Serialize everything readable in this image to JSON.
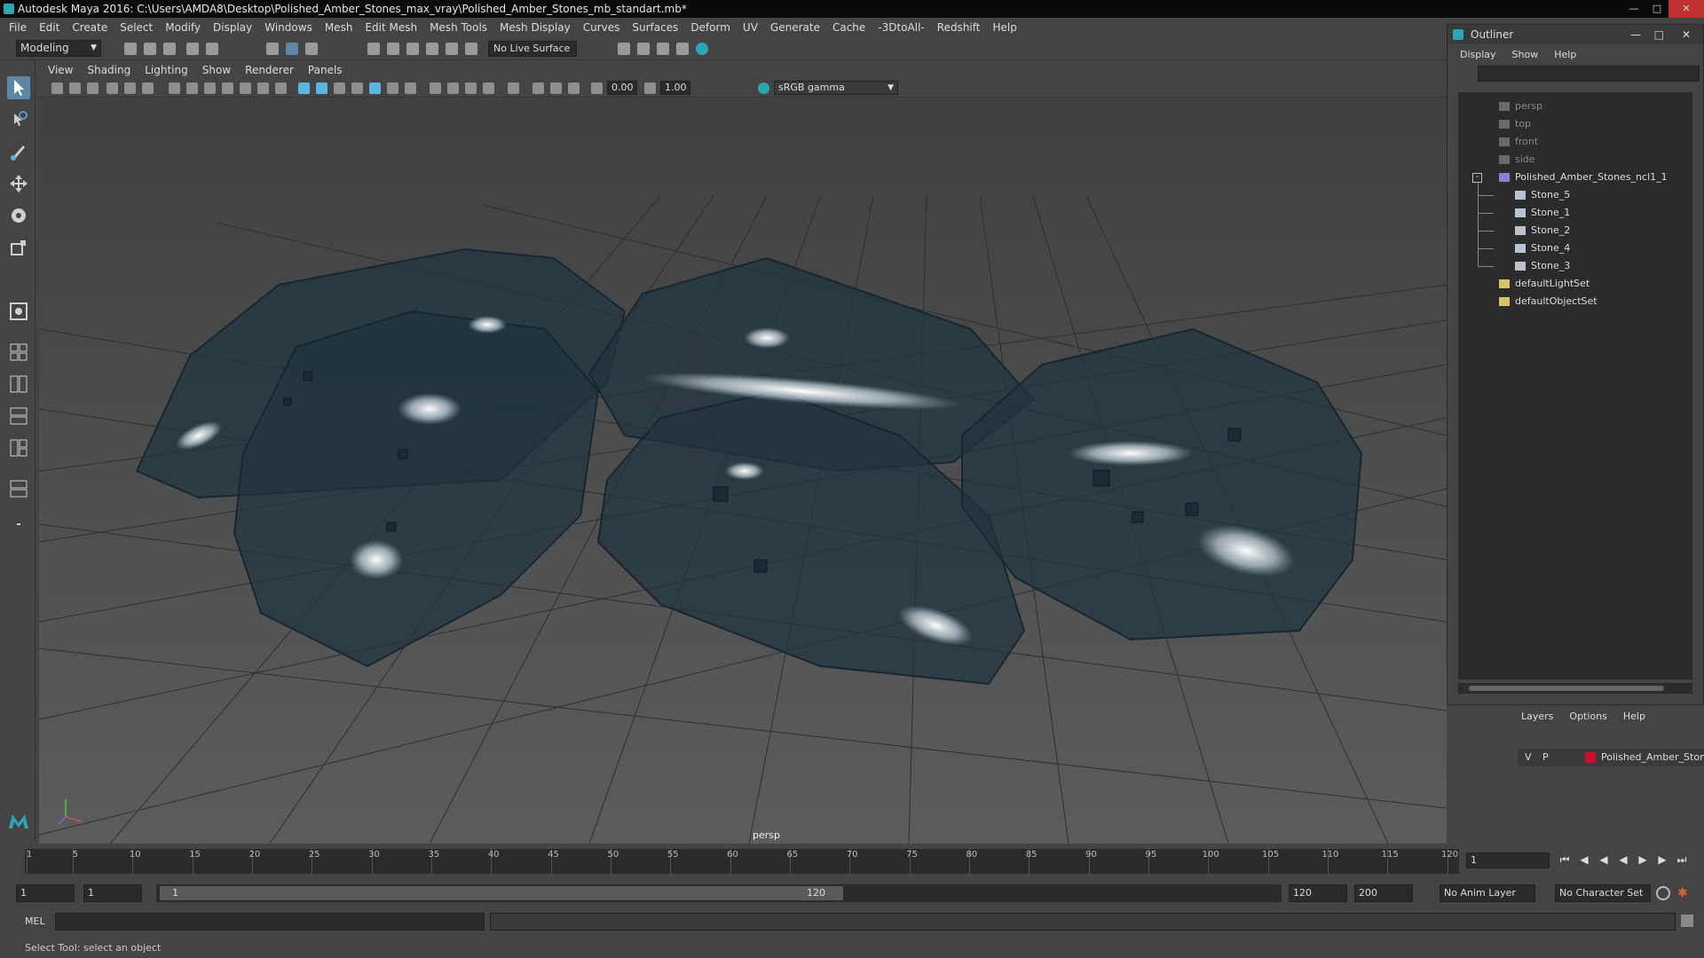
{
  "window": {
    "title": "Autodesk Maya 2016: C:\\Users\\AMDA8\\Desktop\\Polished_Amber_Stones_max_vray\\Polished_Amber_Stones_mb_standart.mb*"
  },
  "menubar": [
    "File",
    "Edit",
    "Create",
    "Select",
    "Modify",
    "Display",
    "Windows",
    "Mesh",
    "Edit Mesh",
    "Mesh Tools",
    "Mesh Display",
    "Curves",
    "Surfaces",
    "Deform",
    "UV",
    "Generate",
    "Cache",
    "-3DtoAll-",
    "Redshift",
    "Help"
  ],
  "shelf": {
    "mode": "Modeling",
    "live_surface": "No Live Surface"
  },
  "viewport": {
    "menus": [
      "View",
      "Shading",
      "Lighting",
      "Show",
      "Renderer",
      "Panels"
    ],
    "field_a": "0.00",
    "field_b": "1.00",
    "color_space": "sRGB gamma",
    "camera_label": "persp"
  },
  "outliner": {
    "title": "Outliner",
    "menus": [
      "Display",
      "Show",
      "Help"
    ],
    "cameras": [
      "persp",
      "top",
      "front",
      "side"
    ],
    "group": "Polished_Amber_Stones_ncl1_1",
    "children": [
      "Stone_5",
      "Stone_1",
      "Stone_2",
      "Stone_4",
      "Stone_3"
    ],
    "sets": [
      "defaultLightSet",
      "defaultObjectSet"
    ]
  },
  "layers": {
    "menus": [
      "Layers",
      "Options",
      "Help"
    ],
    "row": {
      "v": "V",
      "p": "P",
      "name": "Polished_Amber_Stone",
      "color": "#c8102e"
    }
  },
  "timeline": {
    "ticks": [
      "5",
      "10",
      "15",
      "20",
      "25",
      "30",
      "35",
      "40",
      "45",
      "50",
      "55",
      "60",
      "65",
      "70",
      "75",
      "80",
      "85",
      "90",
      "95",
      "100",
      "105",
      "110",
      "115",
      "120"
    ],
    "start_tick": "1",
    "current_frame": "1"
  },
  "range": {
    "start": "1",
    "start2": "1",
    "thumb_start": "1",
    "thumb_end": "120",
    "end": "120",
    "end2": "200",
    "anim_layer": "No Anim Layer",
    "char_set": "No Character Set"
  },
  "cmd": {
    "label": "MEL"
  },
  "help": "Select Tool: select an object"
}
